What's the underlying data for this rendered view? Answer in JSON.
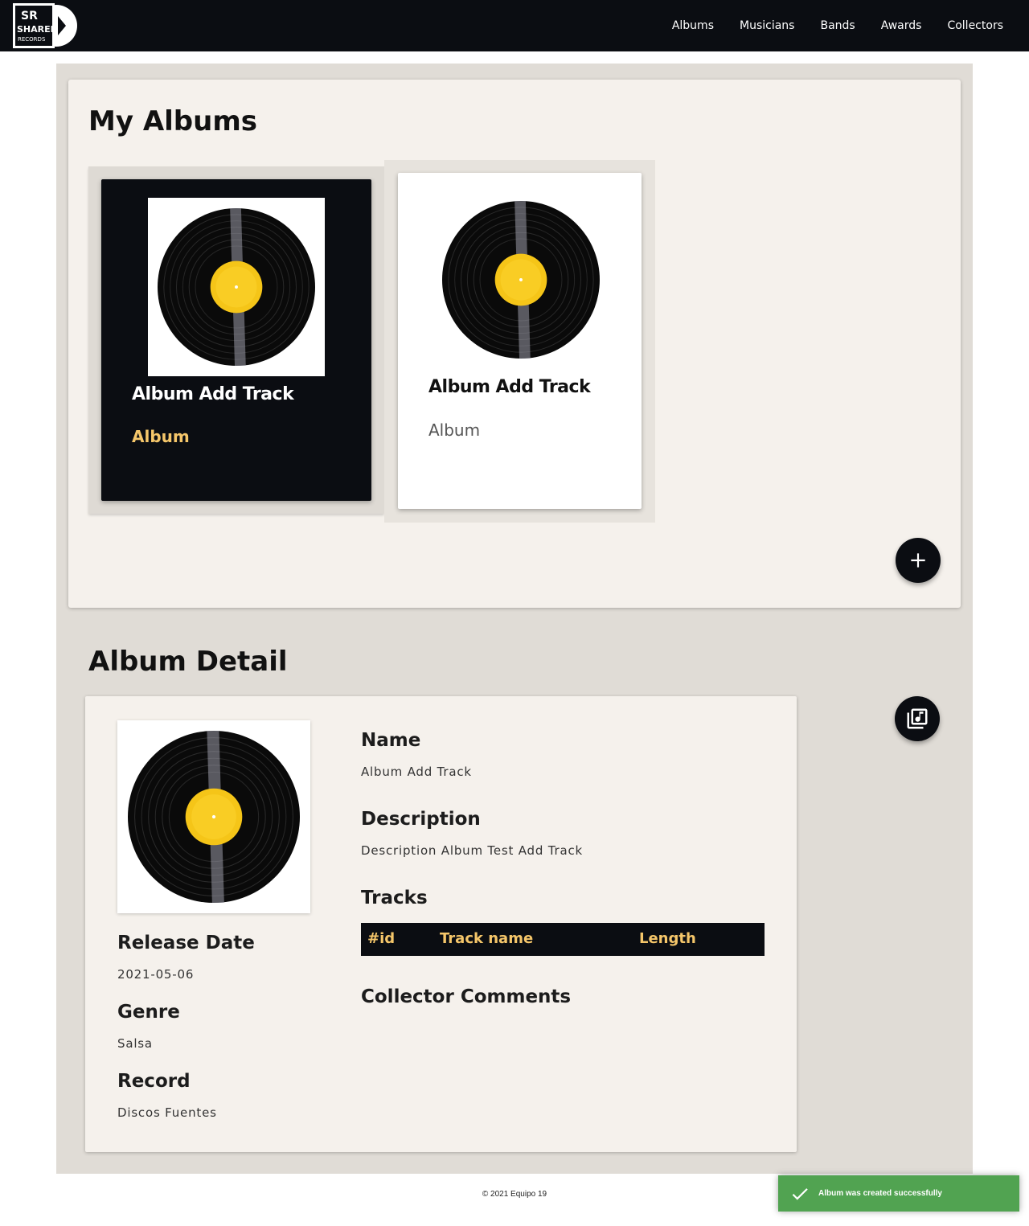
{
  "nav": {
    "logo": {
      "line1": "SR",
      "line2": "SHARED",
      "line3": "RECORDS"
    },
    "links": [
      "Albums",
      "Musicians",
      "Bands",
      "Awards",
      "Collectors"
    ]
  },
  "albums_section": {
    "title": "My Albums",
    "albums": [
      {
        "name": "Album Add Track",
        "type": "Album",
        "selected": true
      },
      {
        "name": "Album Add Track",
        "type": "Album",
        "selected": false
      }
    ],
    "add_button_icon": "plus-icon"
  },
  "detail": {
    "title": "Album Detail",
    "tracks_button_icon": "library-music-icon",
    "release_date_label": "Release Date",
    "release_date": "2021-05-06",
    "genre_label": "Genre",
    "genre": "Salsa",
    "record_label": "Record",
    "record": "Discos Fuentes",
    "name_label": "Name",
    "name": "Album Add Track",
    "description_label": "Description",
    "description": "Description Album Test Add Track",
    "tracks_label": "Tracks",
    "tracks_columns": [
      "#id",
      "Track name",
      "Length"
    ],
    "comments_label": "Collector Comments"
  },
  "footer": {
    "text": "© 2021 Equipo 19"
  },
  "toast": {
    "message": "Album was created successfully",
    "icon": "checkmark-icon",
    "color": "#51a351"
  },
  "colors": {
    "nav_bg": "#0b0d12",
    "accent_gold": "#f5c66a",
    "panel_bg": "#f5f1ec",
    "page_bg": "#e0dcd6"
  }
}
